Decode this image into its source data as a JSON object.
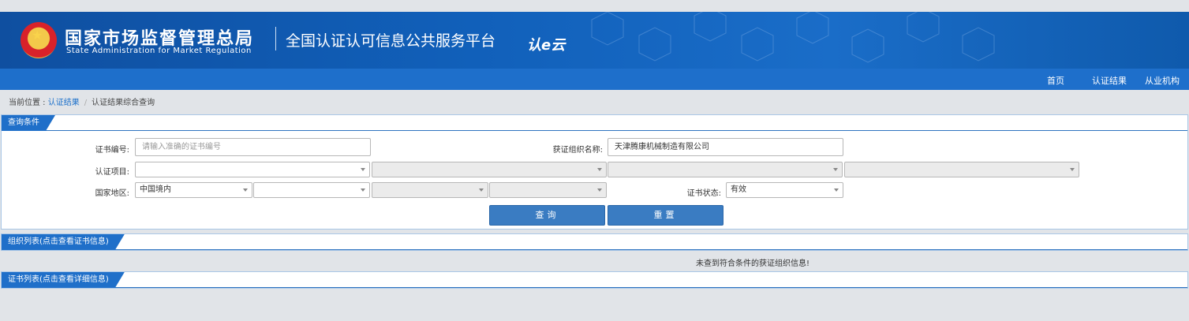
{
  "header": {
    "org_cn": "国家市场监督管理总局",
    "org_en": "State Administration  for  Market Regulation",
    "platform": "全国认证认可信息公共服务平台",
    "logo_text": "认e云"
  },
  "nav": [
    "首页",
    "认证结果",
    "从业机构"
  ],
  "breadcrumb": {
    "prefix": "当前位置 : ",
    "link": "认证结果",
    "current": "认证结果综合查询"
  },
  "query_panel": {
    "title": "查询条件",
    "cert_no": {
      "label": "证书编号:",
      "placeholder": "请输入准确的证书编号"
    },
    "org_name": {
      "label": "获证组织名称:",
      "value": "天津腾康机械制造有限公司"
    },
    "cert_item": {
      "label": "认证项目:"
    },
    "region": {
      "label": "国家地区:",
      "value": "中国境内"
    },
    "status": {
      "label": "证书状态:",
      "value": "有效"
    },
    "query_button": "查询",
    "reset_button": "重置"
  },
  "org_panel": {
    "title": "组织列表(点击查看证书信息)",
    "empty_message": "未查到符合条件的获证组织信息!"
  },
  "cert_panel": {
    "title": "证书列表(点击查看详细信息)"
  },
  "colors": {
    "banner": "#1160ba",
    "navbar": "#1e6fcb",
    "button": "#3a7cc2",
    "page_bg": "#e1e4e8"
  }
}
